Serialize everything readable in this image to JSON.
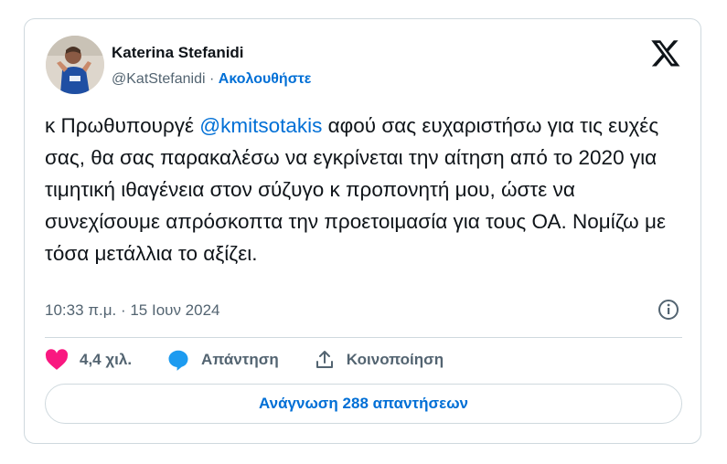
{
  "author": {
    "name": "Katerina Stefanidi",
    "handle": "@KatStefanidi",
    "separator": "·",
    "follow_label": "Ακολουθήστε"
  },
  "tweet": {
    "text_before": "κ Πρωθυπουργέ ",
    "mention": "@kmitsotakis",
    "text_after": " αφού σας ευχαριστήσω για τις ευχές σας, θα σας παρακαλέσω να εγκρίνεται την αίτηση από το 2020 για τιμητική ιθαγένεια στον σύζυγο κ προπονητή μου, ώστε να συνεχίσουμε απρόσκοπτα την προετοιμασία για τους ΟΑ. Νομίζω με τόσα μετάλλια το αξίζει.",
    "timestamp": "10:33 π.μ. · 15 Ιουν 2024"
  },
  "actions": {
    "like_count": "4,4 χιλ.",
    "reply_label": "Απάντηση",
    "share_label": "Κοινοποίηση"
  },
  "read_replies_label": "Ανάγνωση 288 απαντήσεων",
  "colors": {
    "link": "#006fd6",
    "like": "#f91880",
    "reply": "#1d9bf0",
    "muted": "#536471",
    "border": "#cfd9de"
  },
  "icons": [
    "x-logo-icon",
    "info-icon",
    "heart-icon",
    "reply-bubble-icon",
    "share-icon"
  ]
}
